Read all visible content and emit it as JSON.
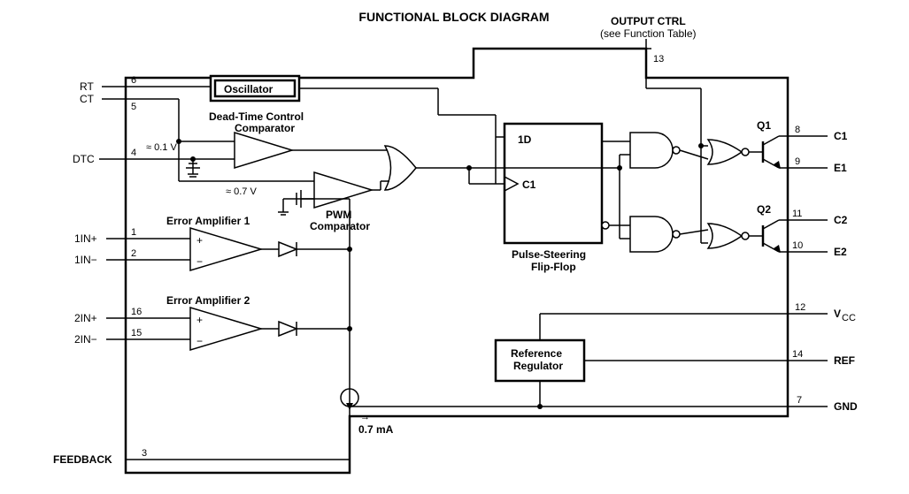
{
  "title": "FUNCTIONAL BLOCK DIAGRAM",
  "pins": {
    "rt": {
      "name": "RT",
      "num": "6"
    },
    "ct": {
      "name": "CT",
      "num": "5"
    },
    "dtc": {
      "name": "DTC",
      "num": "4"
    },
    "in1p": {
      "name": "1IN+",
      "num": "1"
    },
    "in1n": {
      "name": "1IN−",
      "num": "2"
    },
    "in2p": {
      "name": "2IN+",
      "num": "16"
    },
    "in2n": {
      "name": "2IN−",
      "num": "15"
    },
    "fb": {
      "name": "FEEDBACK",
      "num": "3"
    },
    "oc": {
      "name": "OUTPUT CTRL",
      "sub": "(see Function Table)",
      "num": "13"
    },
    "c1": {
      "name": "C1",
      "num": "8"
    },
    "e1": {
      "name": "E1",
      "num": "9"
    },
    "c2": {
      "name": "C2",
      "num": "11"
    },
    "e2": {
      "name": "E2",
      "num": "10"
    },
    "vcc": {
      "name": "V",
      "sub": "CC",
      "num": "12"
    },
    "ref": {
      "name": "REF",
      "num": "14"
    },
    "gnd": {
      "name": "GND",
      "num": "7"
    }
  },
  "blocks": {
    "osc": "Oscillator",
    "dtcmp": "Dead-Time Control Comparator",
    "pwm": "PWM Comparator",
    "ea1": "Error Amplifier 1",
    "ea2": "Error Amplifier 2",
    "ff": "Pulse-Steering Flip-Flop",
    "refreg": "Reference Regulator"
  },
  "ff_port": {
    "d": "1D",
    "ck": "C1"
  },
  "trans": {
    "q1": "Q1",
    "q2": "Q2"
  },
  "offsets": {
    "dtc": "≈ 0.1 V",
    "pwm": "≈ 0.7 V"
  },
  "bias": "0.7 mA"
}
